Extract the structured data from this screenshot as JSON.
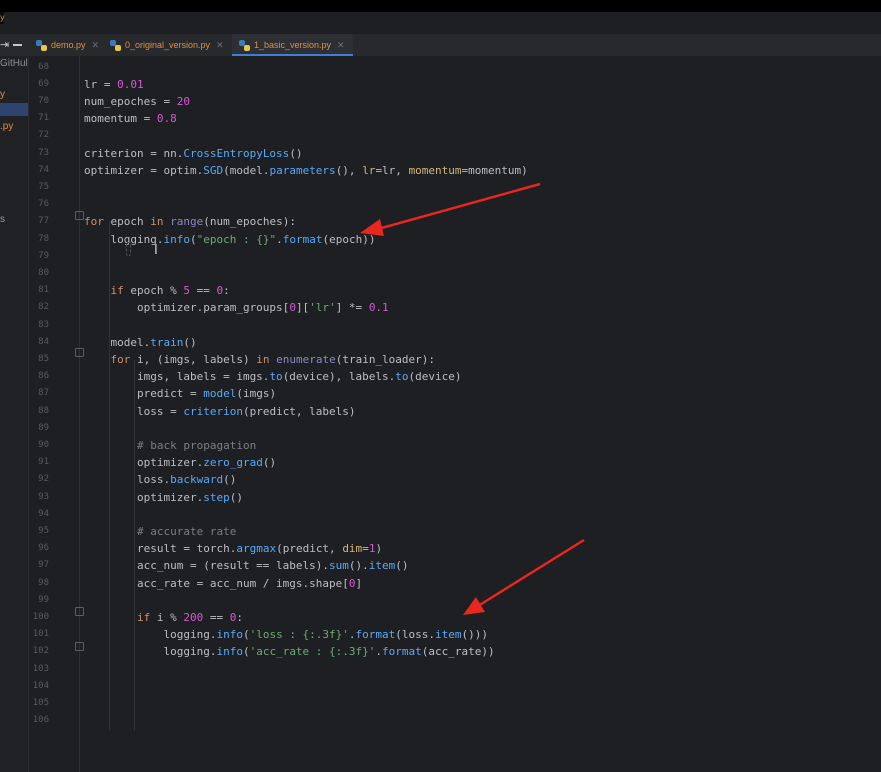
{
  "tabs": [
    {
      "name": "demo.py",
      "active": false
    },
    {
      "name": "0_original_version.py",
      "active": false
    },
    {
      "name": "1_basic_version.py",
      "active": true
    }
  ],
  "project_panel": {
    "items": [
      {
        "text": "GitHul",
        "color": "#8a8d92"
      },
      {
        "text": "y",
        "color": "#e0903a"
      },
      {
        "text": ".py",
        "color": "#e0903a"
      },
      {
        "text": "s",
        "color": "#9a9da2"
      }
    ]
  },
  "colors": {
    "keyword": "#cf8e6d",
    "number": "#d957d6",
    "string": "#6aab73",
    "comment": "#7a7e85",
    "function": "#57aaf7",
    "param": "#d5b778",
    "builtin": "#8888c6",
    "text": "#bcbec4",
    "arrow": "#e8271e"
  },
  "editor": {
    "lines": [
      {
        "n": "68",
        "t": []
      },
      {
        "n": "69",
        "t": [
          [
            "lr = ",
            "text"
          ],
          [
            "0.01",
            "number"
          ]
        ]
      },
      {
        "n": "70",
        "t": [
          [
            "num_epoches = ",
            "text"
          ],
          [
            "20",
            "number"
          ]
        ]
      },
      {
        "n": "71",
        "t": [
          [
            "momentum = ",
            "text"
          ],
          [
            "0.8",
            "number"
          ]
        ]
      },
      {
        "n": "72",
        "t": []
      },
      {
        "n": "73",
        "t": [
          [
            "criterion = nn.",
            "text"
          ],
          [
            "CrossEntropyLoss",
            "function"
          ],
          [
            "()",
            "text"
          ]
        ]
      },
      {
        "n": "74",
        "t": [
          [
            "optimizer = optim.",
            "text"
          ],
          [
            "SGD",
            "function"
          ],
          [
            "(model.",
            "text"
          ],
          [
            "parameters",
            "function"
          ],
          [
            "(), ",
            "text"
          ],
          [
            "lr",
            "param"
          ],
          [
            "=lr, ",
            "text"
          ],
          [
            "momentum",
            "param"
          ],
          [
            "=momentum)",
            "text"
          ]
        ]
      },
      {
        "n": "75",
        "t": []
      },
      {
        "n": "76",
        "t": []
      },
      {
        "n": "77",
        "t": [
          [
            "for",
            "keyword"
          ],
          [
            " epoch ",
            "text"
          ],
          [
            "in",
            "keyword"
          ],
          [
            " ",
            "text"
          ],
          [
            "range",
            "builtin"
          ],
          [
            "(num_epoches):",
            "text"
          ]
        ]
      },
      {
        "n": "78",
        "t": [
          [
            "    logging.",
            "text"
          ],
          [
            "info",
            "function"
          ],
          [
            "(",
            "text"
          ],
          [
            "\"epoch : {}\"",
            "string"
          ],
          [
            ".",
            "text"
          ],
          [
            "format",
            "function"
          ],
          [
            "(epoch))",
            "text"
          ]
        ]
      },
      {
        "n": "79",
        "t": []
      },
      {
        "n": "80",
        "t": []
      },
      {
        "n": "81",
        "t": [
          [
            "    ",
            "text"
          ],
          [
            "if",
            "keyword"
          ],
          [
            " epoch % ",
            "text"
          ],
          [
            "5",
            "number"
          ],
          [
            " == ",
            "text"
          ],
          [
            "0",
            "number"
          ],
          [
            ":",
            "text"
          ]
        ]
      },
      {
        "n": "82",
        "t": [
          [
            "        optimizer.param_groups[",
            "text"
          ],
          [
            "0",
            "number"
          ],
          [
            "][",
            "text"
          ],
          [
            "'lr'",
            "string"
          ],
          [
            "] *= ",
            "text"
          ],
          [
            "0.1",
            "number"
          ]
        ]
      },
      {
        "n": "83",
        "t": []
      },
      {
        "n": "84",
        "t": [
          [
            "    model.",
            "text"
          ],
          [
            "train",
            "function"
          ],
          [
            "()",
            "text"
          ]
        ]
      },
      {
        "n": "85",
        "t": [
          [
            "    ",
            "text"
          ],
          [
            "for",
            "keyword"
          ],
          [
            " i, (imgs, labels) ",
            "text"
          ],
          [
            "in",
            "keyword"
          ],
          [
            " ",
            "text"
          ],
          [
            "enumerate",
            "builtin"
          ],
          [
            "(train_loader):",
            "text"
          ]
        ]
      },
      {
        "n": "86",
        "t": [
          [
            "        imgs, labels = imgs.",
            "text"
          ],
          [
            "to",
            "function"
          ],
          [
            "(device), labels.",
            "text"
          ],
          [
            "to",
            "function"
          ],
          [
            "(device)",
            "text"
          ]
        ]
      },
      {
        "n": "87",
        "t": [
          [
            "        predict = ",
            "text"
          ],
          [
            "model",
            "function"
          ],
          [
            "(imgs)",
            "text"
          ]
        ]
      },
      {
        "n": "88",
        "t": [
          [
            "        loss = ",
            "text"
          ],
          [
            "criterion",
            "function"
          ],
          [
            "(predict, labels)",
            "text"
          ]
        ]
      },
      {
        "n": "89",
        "t": []
      },
      {
        "n": "90",
        "t": [
          [
            "        # back propagation",
            "comment"
          ]
        ]
      },
      {
        "n": "91",
        "t": [
          [
            "        optimizer.",
            "text"
          ],
          [
            "zero_grad",
            "function"
          ],
          [
            "()",
            "text"
          ]
        ]
      },
      {
        "n": "92",
        "t": [
          [
            "        loss.",
            "text"
          ],
          [
            "backward",
            "function"
          ],
          [
            "()",
            "text"
          ]
        ]
      },
      {
        "n": "93",
        "t": [
          [
            "        optimizer.",
            "text"
          ],
          [
            "step",
            "function"
          ],
          [
            "()",
            "text"
          ]
        ]
      },
      {
        "n": "94",
        "t": []
      },
      {
        "n": "95",
        "t": [
          [
            "        # accurate rate",
            "comment"
          ]
        ]
      },
      {
        "n": "96",
        "t": [
          [
            "        result = torch.",
            "text"
          ],
          [
            "argmax",
            "function"
          ],
          [
            "(predict, ",
            "text"
          ],
          [
            "dim",
            "param"
          ],
          [
            "=",
            "text"
          ],
          [
            "1",
            "number"
          ],
          [
            ")",
            "text"
          ]
        ]
      },
      {
        "n": "97",
        "t": [
          [
            "        acc_num = (result == labels).",
            "text"
          ],
          [
            "sum",
            "function"
          ],
          [
            "().",
            "text"
          ],
          [
            "item",
            "function"
          ],
          [
            "()",
            "text"
          ]
        ]
      },
      {
        "n": "98",
        "t": [
          [
            "        acc_rate = acc_num / imgs.shape[",
            "text"
          ],
          [
            "0",
            "number"
          ],
          [
            "]",
            "text"
          ]
        ]
      },
      {
        "n": "99",
        "t": []
      },
      {
        "n": "100",
        "t": [
          [
            "        ",
            "text"
          ],
          [
            "if",
            "keyword"
          ],
          [
            " i % ",
            "text"
          ],
          [
            "200",
            "number"
          ],
          [
            " == ",
            "text"
          ],
          [
            "0",
            "number"
          ],
          [
            ":",
            "text"
          ]
        ]
      },
      {
        "n": "101",
        "t": [
          [
            "            logging.",
            "text"
          ],
          [
            "info",
            "function"
          ],
          [
            "(",
            "text"
          ],
          [
            "'loss : {:.3f}'",
            "string"
          ],
          [
            ".",
            "text"
          ],
          [
            "format",
            "function"
          ],
          [
            "(loss.",
            "text"
          ],
          [
            "item",
            "function"
          ],
          [
            "()))",
            "text"
          ]
        ]
      },
      {
        "n": "102",
        "t": [
          [
            "            logging.",
            "text"
          ],
          [
            "info",
            "function"
          ],
          [
            "(",
            "text"
          ],
          [
            "'acc_rate : {:.3f}'",
            "string"
          ],
          [
            ".",
            "text"
          ],
          [
            "format",
            "function"
          ],
          [
            "(acc_rate))",
            "text"
          ]
        ]
      },
      {
        "n": "103",
        "t": []
      },
      {
        "n": "104",
        "t": []
      },
      {
        "n": "105",
        "t": []
      },
      {
        "n": "106",
        "t": []
      }
    ]
  }
}
